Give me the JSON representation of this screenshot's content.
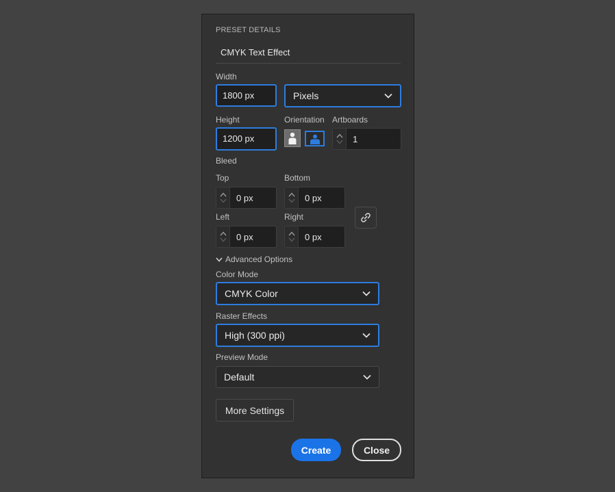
{
  "preset": {
    "section_title": "PRESET DETAILS",
    "name": "CMYK Text Effect"
  },
  "width": {
    "label": "Width",
    "value": "1800 px"
  },
  "units": {
    "selected": "Pixels"
  },
  "height": {
    "label": "Height",
    "value": "1200 px"
  },
  "orientation": {
    "label": "Orientation",
    "options": [
      "portrait",
      "landscape"
    ],
    "selected": "landscape"
  },
  "artboards": {
    "label": "Artboards",
    "value": "1"
  },
  "bleed": {
    "label": "Bleed",
    "top": {
      "label": "Top",
      "value": "0 px"
    },
    "bottom": {
      "label": "Bottom",
      "value": "0 px"
    },
    "left": {
      "label": "Left",
      "value": "0 px"
    },
    "right": {
      "label": "Right",
      "value": "0 px"
    }
  },
  "advanced": {
    "label": "Advanced Options",
    "expanded": true
  },
  "color_mode": {
    "label": "Color Mode",
    "selected": "CMYK Color"
  },
  "raster_effects": {
    "label": "Raster Effects",
    "selected": "High (300 ppi)"
  },
  "preview_mode": {
    "label": "Preview Mode",
    "selected": "Default"
  },
  "buttons": {
    "more_settings": "More Settings",
    "create": "Create",
    "close": "Close"
  },
  "colors": {
    "accent": "#2d7de0",
    "primary_button": "#1b73e8",
    "panel": "#323232",
    "background": "#424242"
  }
}
